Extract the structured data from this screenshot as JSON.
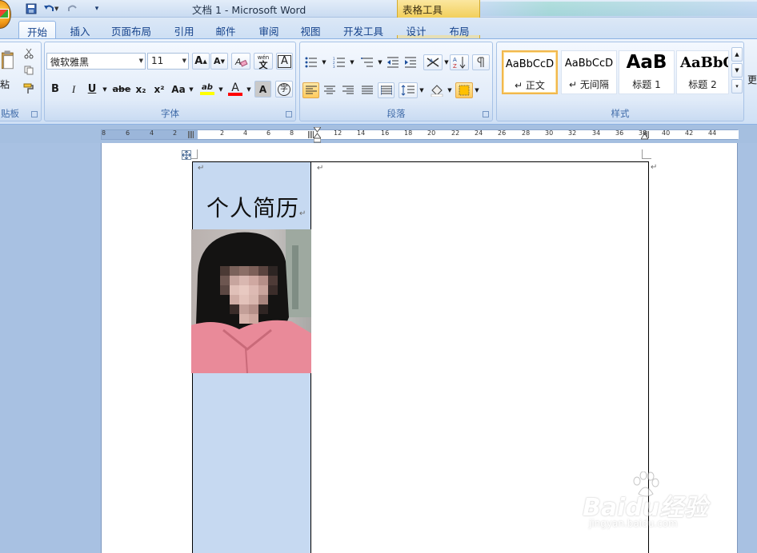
{
  "window": {
    "title": "文档 1 - Microsoft Word",
    "context_tab_title": "表格工具"
  },
  "tabs": [
    {
      "label": "开始",
      "active": true
    },
    {
      "label": "插入"
    },
    {
      "label": "页面布局"
    },
    {
      "label": "引用"
    },
    {
      "label": "邮件"
    },
    {
      "label": "审阅"
    },
    {
      "label": "视图"
    },
    {
      "label": "开发工具"
    },
    {
      "label": "设计",
      "context": true
    },
    {
      "label": "布局",
      "context": true
    }
  ],
  "ribbon": {
    "clipboard": {
      "label": "贴板",
      "paste_label": "粘"
    },
    "font": {
      "label": "字体",
      "font_name": "微软雅黑",
      "font_size": "11",
      "grow_font": "A",
      "shrink_font": "A",
      "change_case": "Aa",
      "bold": "B",
      "italic": "I",
      "underline": "U",
      "strike": "abe",
      "subscript": "x₂",
      "superscript": "x²",
      "highlight_label": "ab",
      "font_color_label": "A",
      "char_shading": "A",
      "phonetic": "wén",
      "clear_format": "A",
      "enclose_char": "字",
      "highlight_color": "#ffff00",
      "font_color": "#ff0000"
    },
    "paragraph": {
      "label": "段落",
      "shading_color": "#ffc000"
    },
    "styles": {
      "label": "样式",
      "cards": [
        {
          "sample": "AaBbCcD",
          "name": "正文",
          "selected": true
        },
        {
          "sample": "AaBbCcD",
          "name": "无间隔"
        },
        {
          "sample": "AaB",
          "name": "标题 1"
        },
        {
          "sample": "AaBbC",
          "name": "标题 2"
        }
      ],
      "more_label": "更"
    }
  },
  "ruler": {
    "numbers_left": [
      "8",
      "6",
      "4",
      "2"
    ],
    "numbers_right": [
      "2",
      "4",
      "6",
      "8",
      "10",
      "12",
      "14",
      "16",
      "18",
      "20",
      "22",
      "24",
      "26",
      "28",
      "30",
      "32",
      "34",
      "36",
      "38",
      "40",
      "42",
      "44"
    ]
  },
  "document": {
    "resume_title": "个人简历",
    "para_mark": "↵",
    "table_move_handle": "+"
  },
  "watermark": {
    "brand": "Baidu经验",
    "url": "jingyan.baidu.com"
  },
  "colors": {
    "cell_shading": "#c6d9f1",
    "ribbon_blue": "#15428b",
    "context_yellow": "#f2cf5c"
  }
}
